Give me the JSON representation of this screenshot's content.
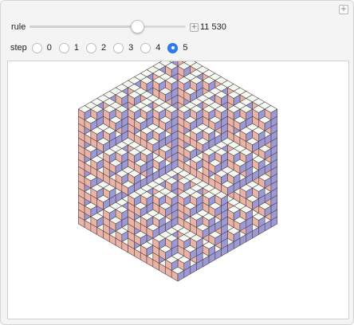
{
  "controls": {
    "rule_label": "rule",
    "rule_value": "11 530",
    "rule_slider_fraction": 0.69,
    "step_label": "step",
    "step_options": [
      "0",
      "1",
      "2",
      "3",
      "4",
      "5"
    ],
    "step_selected": "5"
  },
  "icons": {
    "panel_corner": "plus-icon",
    "slider_expand": "plus-icon"
  },
  "colors": {
    "top_face": "#f3faf3",
    "left_face": "#e8b4a8",
    "right_face": "#9a9ad6",
    "edge": "#5a4040",
    "radio_selected": "#2f7bf6"
  }
}
